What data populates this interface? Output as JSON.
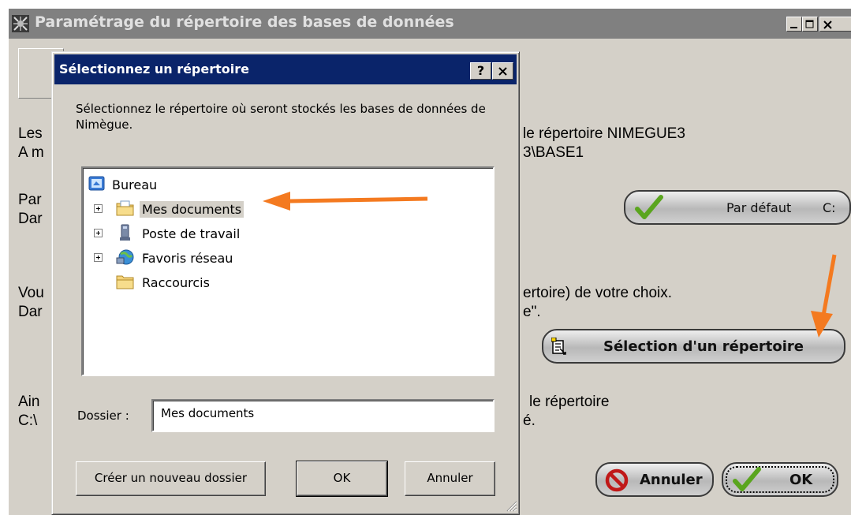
{
  "main_window": {
    "title": "Paramétrage du répertoire des bases de données",
    "text_lines": [
      {
        "id": "les",
        "text": "Les"
      },
      {
        "id": "am",
        "text": "A m"
      },
      {
        "id": "par",
        "text": "Par"
      },
      {
        "id": "dar1",
        "text": "Dar"
      },
      {
        "id": "vou",
        "text": "Vou"
      },
      {
        "id": "dar2",
        "text": "Dar"
      },
      {
        "id": "ain",
        "text": "Ain"
      },
      {
        "id": "cpath",
        "text": "C:\\"
      }
    ],
    "right_text": {
      "line1": "le répertoire NIMEGUE3",
      "line2": "3\\BASE1",
      "line3": "ertoire) de votre choix.",
      "line4": "e\".",
      "line5": "le répertoire",
      "line6": "é."
    },
    "buttons": {
      "default_label": "Par défaut",
      "default_drive": "C:",
      "select_dir_label": "Sélection d'un répertoire",
      "cancel_label": "Annuler",
      "ok_label": "OK"
    }
  },
  "dialog": {
    "title": "Sélectionnez un répertoire",
    "help_label": "?",
    "description": "Sélectionnez le répertoire où seront stockés les bases de données de Nimègue.",
    "tree": {
      "root": "Bureau",
      "items": [
        {
          "label": "Mes documents",
          "icon": "my-documents-icon",
          "expandable": true,
          "selected": true
        },
        {
          "label": "Poste de travail",
          "icon": "my-computer-icon",
          "expandable": true,
          "selected": false
        },
        {
          "label": "Favoris réseau",
          "icon": "network-places-icon",
          "expandable": true,
          "selected": false
        },
        {
          "label": "Raccourcis",
          "icon": "folder-icon",
          "expandable": false,
          "selected": false
        }
      ]
    },
    "folder_label": "Dossier :",
    "folder_value": "Mes documents",
    "buttons": {
      "new_folder": "Créer un nouveau dossier",
      "ok": "OK",
      "cancel": "Annuler"
    }
  },
  "colors": {
    "dialog_titlebar": "#0a246a",
    "inactive_titlebar": "#808080",
    "face": "#d4d0c8",
    "annotation_arrow": "#f47a20",
    "check_green": "#5aa51e",
    "cancel_red": "#c01818"
  }
}
